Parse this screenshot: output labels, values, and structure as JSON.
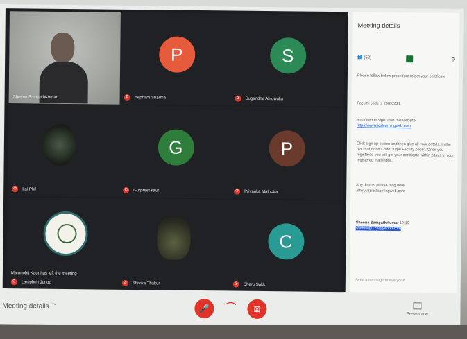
{
  "participants": [
    {
      "name": "Sheena SampathKumar",
      "initial": "",
      "kind": "photo-me"
    },
    {
      "name": "Hepham Sharma",
      "initial": "P",
      "color": "#e55b3c"
    },
    {
      "name": "Sugandha Ahluwalia",
      "initial": "S",
      "color": "#2b8a55"
    },
    {
      "name": "Lai Phil",
      "initial": "",
      "kind": "photo-art"
    },
    {
      "name": "Gurpreet kaur",
      "initial": "G",
      "color": "#2f7d3a"
    },
    {
      "name": "Priyanka Malhotra",
      "initial": "P",
      "color": "#6a3a2c"
    },
    {
      "name": "Lamphon Jungo",
      "initial": "",
      "kind": "photo-logo",
      "toast": "Mamnohit Kaur has left the meeting"
    },
    {
      "name": "Shivika Thakur",
      "initial": "",
      "kind": "photo-thakur"
    },
    {
      "name": "Charu Sakk",
      "initial": "C",
      "color": "#2a9a94"
    }
  ],
  "panel": {
    "title": "Meeting details",
    "people_count": "(52)",
    "messages": [
      "Please follow below procedure to get your certificate",
      "Faculty code is 29092021",
      "You need to sign up in this website",
      "https://www.icslearningweb.com",
      "Click sign up button and then give all your details. In the place of Enter Code \"Type Faculty code\". Once you registered you will get your certificate within 2days in your registered mail inbox.",
      "Any doubts please ping here",
      "athiryu@icslearningweb.com"
    ],
    "sender": "Sheena SampathKumar",
    "sender_time": "12:19",
    "sender_email": "sheena@123@yahoo.com",
    "compose_placeholder": "Send a message to everyone"
  },
  "bottom": {
    "details_label": "Meeting details",
    "present_label": "Present now"
  },
  "colors": {
    "mute_red": "#d93a2f",
    "end_call_red": "#e0342a",
    "chat_green": "#137333"
  }
}
